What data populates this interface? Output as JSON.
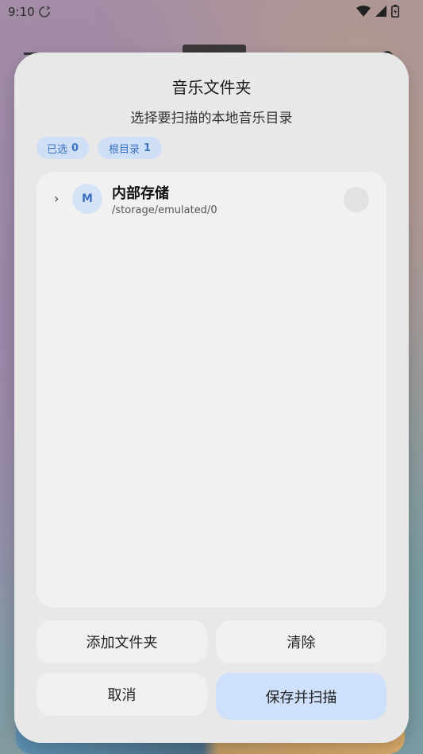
{
  "status_bar": {
    "time": "9:10",
    "icons": [
      "sync-icon",
      "wifi-icon",
      "signal-icon",
      "battery-icon"
    ]
  },
  "dialog": {
    "title": "音乐文件夹",
    "subtitle": "选择要扫描的本地音乐目录",
    "chips": {
      "selected_label": "已选",
      "selected_count": "0",
      "roots_label": "根目录",
      "roots_count": "1"
    },
    "tree": [
      {
        "avatar_letter": "M",
        "name": "内部存储",
        "path": "/storage/emulated/0",
        "expand_glyph": "›"
      }
    ],
    "buttons": {
      "add_folder": "添加文件夹",
      "clear": "清除",
      "cancel": "取消",
      "save_and_scan": "保存并扫描"
    }
  },
  "colors": {
    "accent": "#3d73c4",
    "chip_bg": "#cfe0f6",
    "primary_button_bg": "#cfe0fb",
    "dialog_bg": "#e8e8e8"
  }
}
